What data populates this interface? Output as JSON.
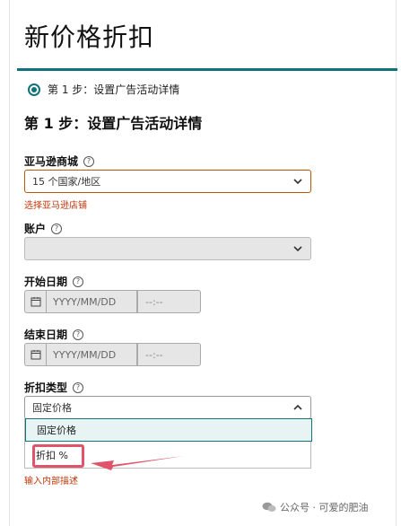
{
  "page": {
    "title": "新价格折扣"
  },
  "step": {
    "indicator_label": "第 1 步：设置广告活动详情",
    "heading": "第 1 步：设置广告活动详情"
  },
  "marketplace": {
    "label": "亚马逊商城",
    "value": "15 个国家/地区",
    "error": "选择亚马逊店铺"
  },
  "account": {
    "label": "账户",
    "value": ""
  },
  "start_date": {
    "label": "开始日期",
    "date_placeholder": "YYYY/MM/DD",
    "time_placeholder": "--:--"
  },
  "end_date": {
    "label": "结束日期",
    "date_placeholder": "YYYY/MM/DD",
    "time_placeholder": "--:--"
  },
  "discount_type": {
    "label": "折扣类型",
    "value": "固定价格",
    "options": [
      "固定价格",
      "折扣 %"
    ],
    "error": "输入内部描述"
  },
  "help_icon_text": "?",
  "watermark": {
    "text": "公众号 · 可爱的肥油"
  },
  "colors": {
    "accent": "#11727a",
    "error": "#c0380c",
    "highlight": "#e0536a"
  }
}
